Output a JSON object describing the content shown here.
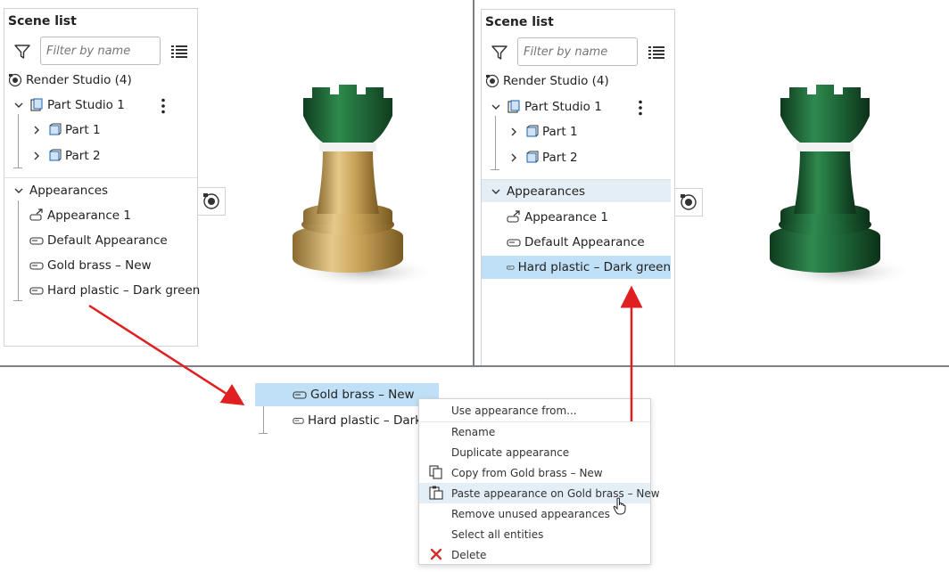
{
  "left_panel": {
    "title": "Scene list",
    "filter_placeholder": "Filter by name",
    "render_studio": "Render Studio (4)",
    "part_studio": "Part Studio 1",
    "parts": [
      "Part 1",
      "Part 2"
    ],
    "appearances_header": "Appearances",
    "appearances": [
      "Appearance 1",
      "Default Appearance",
      "Gold brass – New",
      "Hard plastic – Dark green"
    ]
  },
  "right_panel": {
    "title": "Scene list",
    "filter_placeholder": "Filter by name",
    "render_studio": "Render Studio (4)",
    "part_studio": "Part Studio 1",
    "parts": [
      "Part 1",
      "Part 2"
    ],
    "appearances_header": "Appearances",
    "appearances": [
      "Appearance 1",
      "Default Appearance",
      "Hard plastic – Dark green"
    ],
    "selected_appearance": "Hard plastic – Dark green"
  },
  "bottom_snippet": {
    "items": [
      "Gold brass – New",
      "Hard plastic – Dark"
    ]
  },
  "context_menu": {
    "items": [
      "Use appearance from...",
      "Rename",
      "Duplicate appearance",
      "Copy from Gold brass – New",
      "Paste appearance on Gold brass – New",
      "Remove unused appearances",
      "Select all entities",
      "Delete"
    ],
    "highlighted": "Paste appearance on Gold brass – New"
  },
  "colors": {
    "selection": "#bfe0f6",
    "arrow": "#e02020",
    "gold": "#c9a45a",
    "dark_green": "#1f6b3a",
    "delete_x": "#d32f2f"
  }
}
